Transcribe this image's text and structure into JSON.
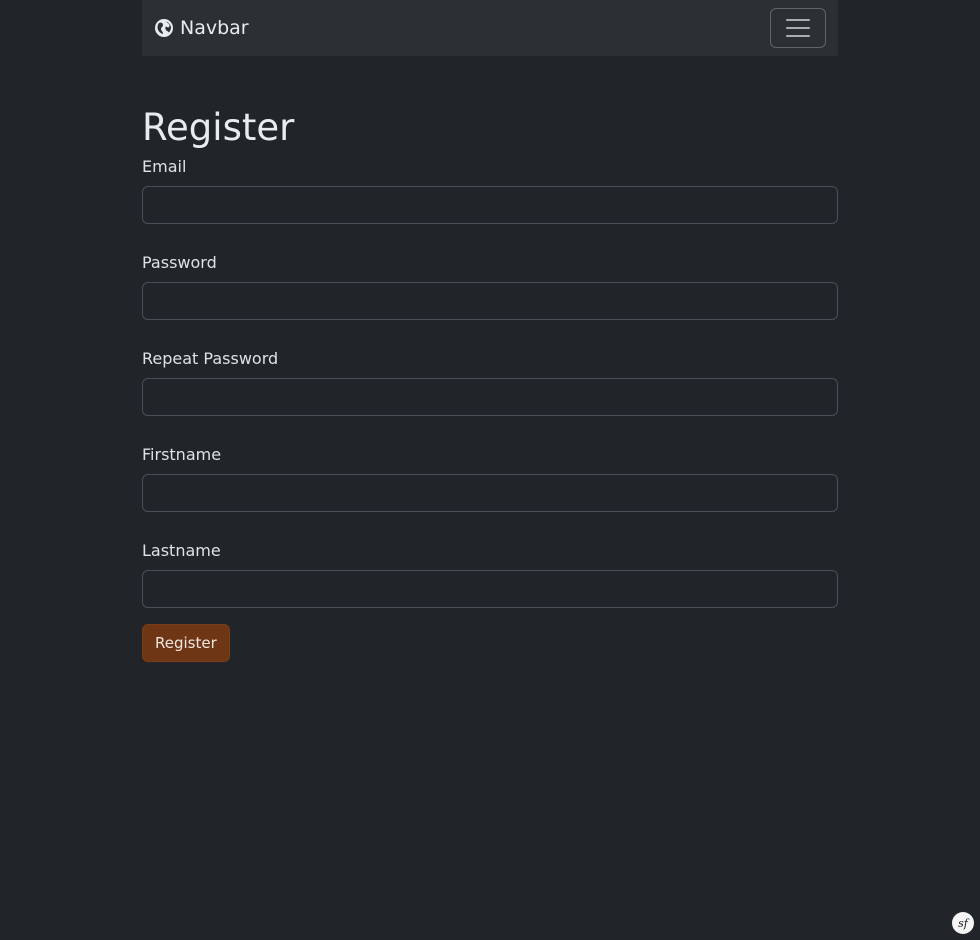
{
  "navbar": {
    "brand_label": "Navbar",
    "brand_icon": "globe-icon",
    "toggler_icon": "hamburger-menu-icon"
  },
  "page": {
    "title": "Register"
  },
  "form": {
    "email": {
      "label": "Email",
      "value": "",
      "placeholder": ""
    },
    "password": {
      "label": "Password",
      "value": "",
      "placeholder": ""
    },
    "repeat_password": {
      "label": "Repeat Password",
      "value": "",
      "placeholder": ""
    },
    "firstname": {
      "label": "Firstname",
      "value": "",
      "placeholder": ""
    },
    "lastname": {
      "label": "Lastname",
      "value": "",
      "placeholder": ""
    },
    "submit_label": "Register"
  },
  "debug_toolbar": {
    "badge_text": "sf",
    "icon": "symfony-icon"
  },
  "colors": {
    "background": "#212529",
    "navbar": "#2b3035",
    "primary_button": "#6e3615"
  }
}
